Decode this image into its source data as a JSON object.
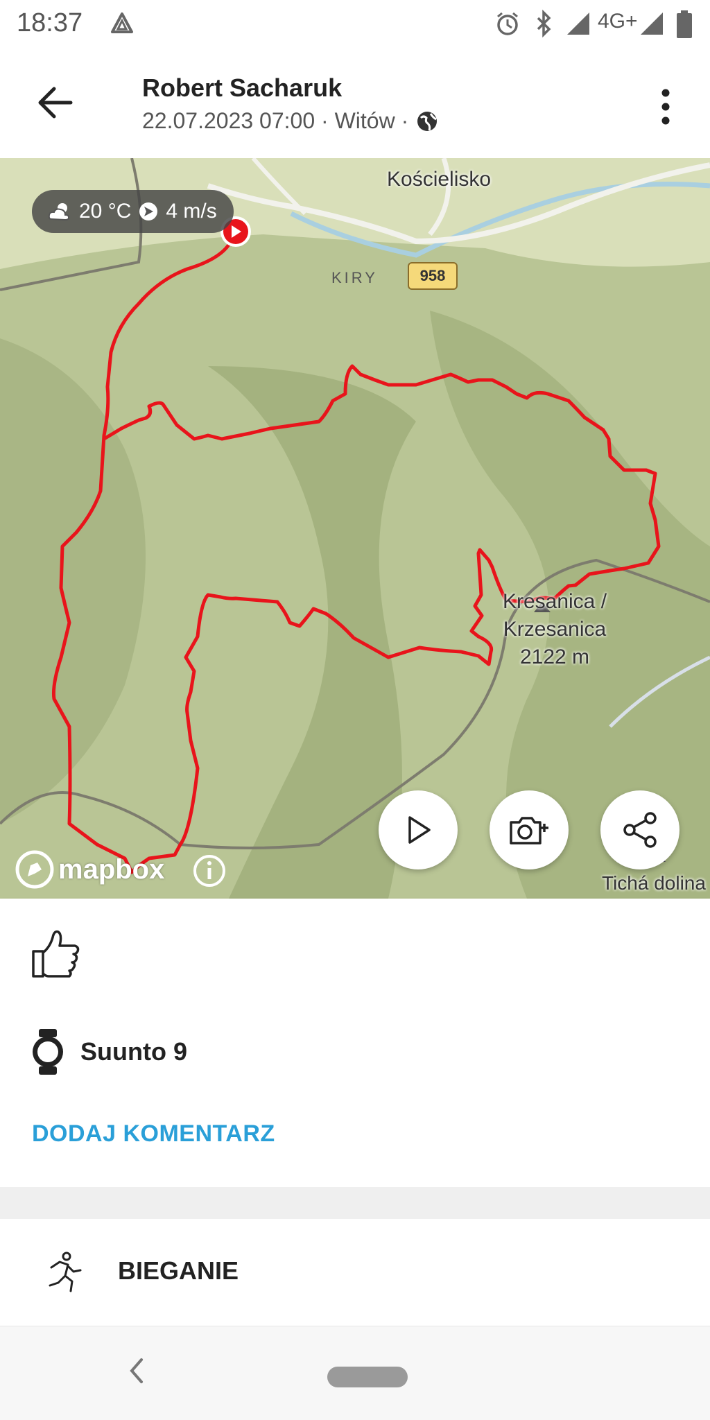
{
  "status_bar": {
    "time": "18:37",
    "network": "4G+",
    "icons": [
      "assistant-icon",
      "alarm-icon",
      "bluetooth-icon",
      "signal-icon",
      "battery-icon"
    ]
  },
  "header": {
    "name": "Robert Sacharuk",
    "meta": "22.07.2023 07:00 · Witów ·",
    "icons": [
      "back-arrow-icon",
      "globe-icon",
      "more-vert-icon"
    ]
  },
  "map": {
    "weather": {
      "temperature": "20 °C",
      "wind": "4 m/s"
    },
    "labels": {
      "town": "Kościelisko",
      "village": "KIRY",
      "road_number": "958",
      "peak_name_1": "Kresanica /",
      "peak_name_2": "Krzesanica",
      "peak_elevation": "2122 m",
      "valley": "Tichá dolina"
    },
    "attribution": "mapbox",
    "route_color": "#e8141b",
    "buttons": [
      "play-icon",
      "add-photo-icon",
      "share-icon"
    ]
  },
  "card": {
    "device": "Suunto 9",
    "comment_label": "DODAJ KOMENTARZ",
    "accent_color": "#2a9fd8"
  },
  "activity": {
    "label": "BIEGANIE"
  }
}
